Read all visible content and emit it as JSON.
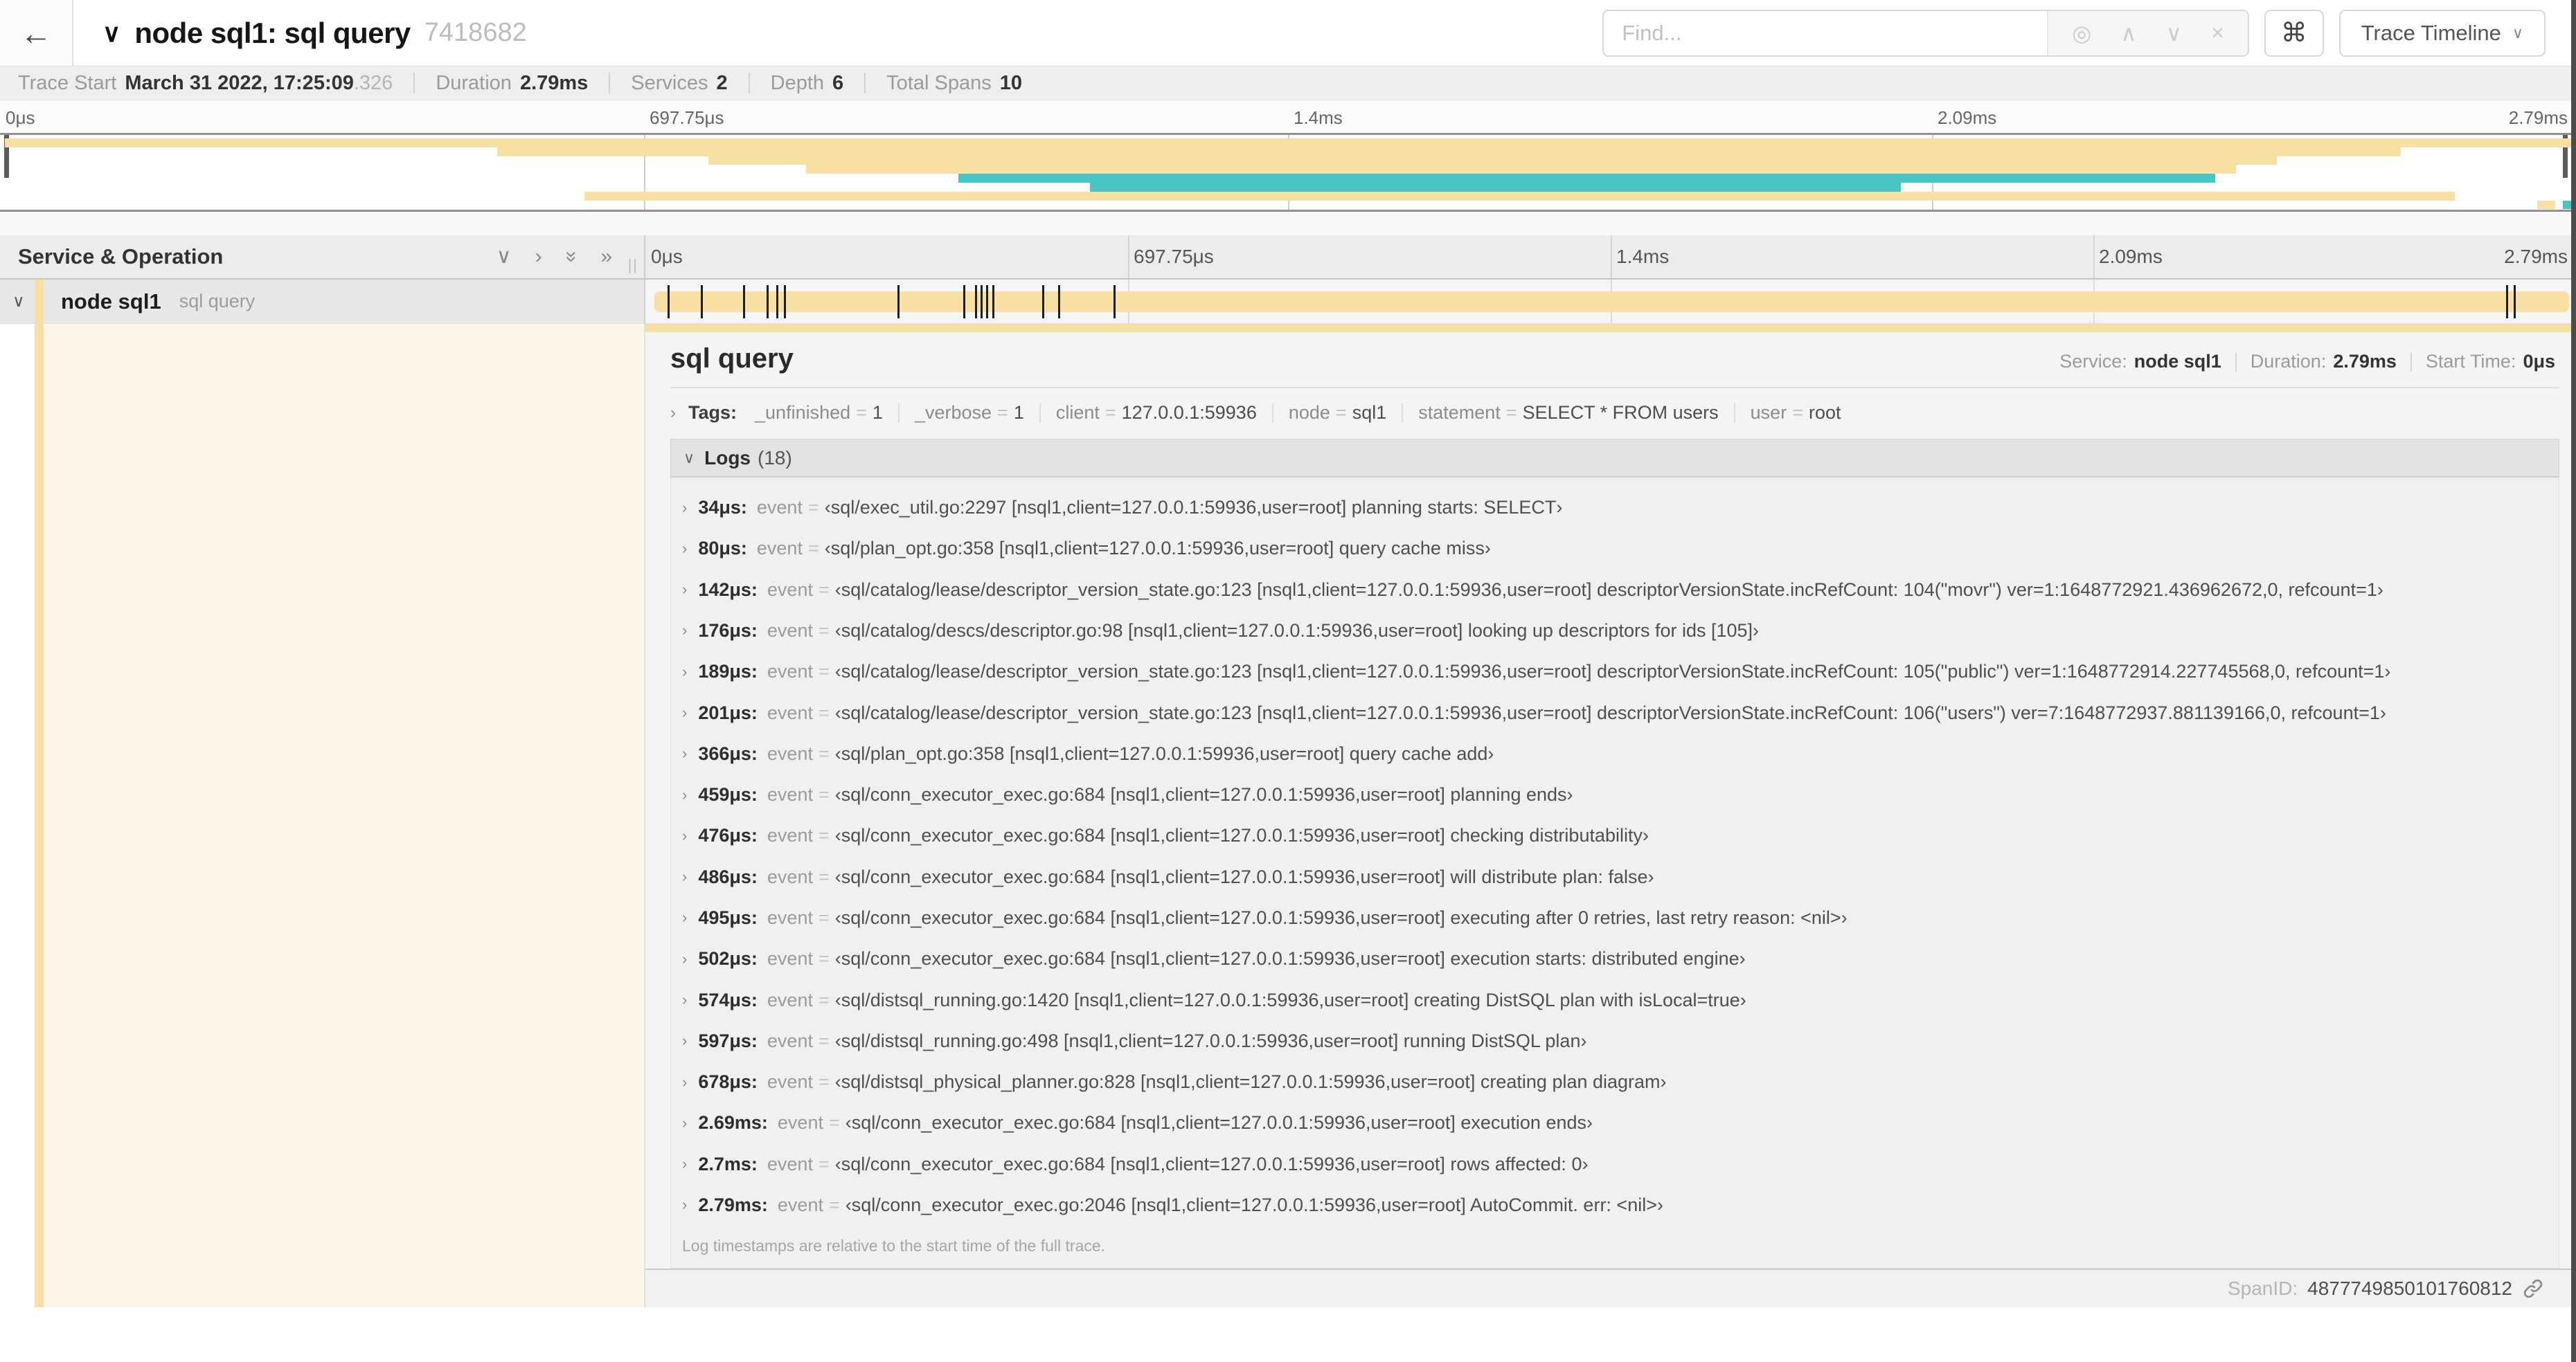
{
  "colors": {
    "tan": "#f8dfa4",
    "teal": "#49c6c3"
  },
  "icons": {
    "back": "←",
    "collapse": "∨",
    "locate": "◎",
    "prev": "∧",
    "next": "∨",
    "clear": "×",
    "shortcut": "⌘",
    "dropdown": "∨",
    "chevron_right": "›",
    "chevron_down": "∨",
    "double_right": "»",
    "grip": "||"
  },
  "header": {
    "title": "node sql1: sql query",
    "trace_id": "7418682",
    "find_placeholder": "Find...",
    "view_button": "Trace Timeline"
  },
  "stats": {
    "trace_start_label": "Trace Start",
    "trace_start": "March 31 2022, 17:25:09",
    "trace_start_frac": ".326",
    "duration_label": "Duration",
    "duration": "2.79ms",
    "services_label": "Services",
    "services": "2",
    "depth_label": "Depth",
    "depth": "6",
    "spans_label": "Total Spans",
    "spans": "10"
  },
  "ruler": {
    "labels": [
      "0μs",
      "697.75μs",
      "1.4ms",
      "2.09ms",
      "2.79ms"
    ]
  },
  "minimap": {
    "rows": [
      {
        "row": 0,
        "start": 0.2,
        "end": 99.8,
        "color": "tan"
      },
      {
        "row": 1,
        "start": 19.3,
        "end": 93.2,
        "color": "tan"
      },
      {
        "row": 2,
        "start": 27.5,
        "end": 88.4,
        "color": "tan"
      },
      {
        "row": 3,
        "start": 31.3,
        "end": 86.8,
        "color": "tan"
      },
      {
        "row": 4,
        "start": 37.2,
        "end": 86.0,
        "color": "teal"
      },
      {
        "row": 5,
        "start": 42.3,
        "end": 73.8,
        "color": "teal"
      },
      {
        "row": 6,
        "start": 22.7,
        "end": 95.3,
        "color": "tan"
      },
      {
        "row": 7,
        "start": 98.5,
        "end": 99.2,
        "color": "tan"
      },
      {
        "row": 7,
        "start": 99.5,
        "end": 100,
        "color": "teal"
      }
    ]
  },
  "tree": {
    "header": "Service & Operation",
    "service": "node sql1",
    "operation": "sql query"
  },
  "span_detail": {
    "title": "sql query",
    "service_label": "Service:",
    "service": "node sql1",
    "duration_label": "Duration:",
    "duration": "2.79ms",
    "start_label": "Start Time:",
    "start": "0μs",
    "tags_label": "Tags:",
    "tags": [
      {
        "key": "_unfinished",
        "value": "1"
      },
      {
        "key": "_verbose",
        "value": "1"
      },
      {
        "key": "client",
        "value": "127.0.0.1:59936"
      },
      {
        "key": "node",
        "value": "sql1"
      },
      {
        "key": "statement",
        "value": "SELECT * FROM users"
      },
      {
        "key": "user",
        "value": "root"
      }
    ],
    "logs_label": "Logs",
    "logs_count": "(18)",
    "log_key": "event",
    "logs": [
      {
        "time": "34μs:",
        "pct": 1.2,
        "value": "‹sql/exec_util.go:2297 [nsql1,client=127.0.0.1:59936,user=root] planning starts: SELECT›"
      },
      {
        "time": "80μs:",
        "pct": 2.9,
        "value": "‹sql/plan_opt.go:358 [nsql1,client=127.0.0.1:59936,user=root] query cache miss›"
      },
      {
        "time": "142μs:",
        "pct": 5.1,
        "value": "‹sql/catalog/lease/descriptor_version_state.go:123 [nsql1,client=127.0.0.1:59936,user=root] descriptorVersionState.incRefCount: 104(\"movr\") ver=1:1648772921.436962672,0, refcount=1›"
      },
      {
        "time": "176μs:",
        "pct": 6.3,
        "value": "‹sql/catalog/descs/descriptor.go:98 [nsql1,client=127.0.0.1:59936,user=root] looking up descriptors for ids [105]›"
      },
      {
        "time": "189μs:",
        "pct": 6.8,
        "value": "‹sql/catalog/lease/descriptor_version_state.go:123 [nsql1,client=127.0.0.1:59936,user=root] descriptorVersionState.incRefCount: 105(\"public\") ver=1:1648772914.227745568,0, refcount=1›"
      },
      {
        "time": "201μs:",
        "pct": 7.2,
        "value": "‹sql/catalog/lease/descriptor_version_state.go:123 [nsql1,client=127.0.0.1:59936,user=root] descriptorVersionState.incRefCount: 106(\"users\") ver=7:1648772937.881139166,0, refcount=1›"
      },
      {
        "time": "366μs:",
        "pct": 13.1,
        "value": "‹sql/plan_opt.go:358 [nsql1,client=127.0.0.1:59936,user=root] query cache add›"
      },
      {
        "time": "459μs:",
        "pct": 16.5,
        "value": "‹sql/conn_executor_exec.go:684 [nsql1,client=127.0.0.1:59936,user=root] planning ends›"
      },
      {
        "time": "476μs:",
        "pct": 17.1,
        "value": "‹sql/conn_executor_exec.go:684 [nsql1,client=127.0.0.1:59936,user=root] checking distributability›"
      },
      {
        "time": "486μs:",
        "pct": 17.4,
        "value": "‹sql/conn_executor_exec.go:684 [nsql1,client=127.0.0.1:59936,user=root] will distribute plan: false›"
      },
      {
        "time": "495μs:",
        "pct": 17.7,
        "value": "‹sql/conn_executor_exec.go:684 [nsql1,client=127.0.0.1:59936,user=root] executing after 0 retries, last retry reason: <nil>›"
      },
      {
        "time": "502μs:",
        "pct": 18.0,
        "value": "‹sql/conn_executor_exec.go:684 [nsql1,client=127.0.0.1:59936,user=root] execution starts: distributed engine›"
      },
      {
        "time": "574μs:",
        "pct": 20.6,
        "value": "‹sql/distsql_running.go:1420 [nsql1,client=127.0.0.1:59936,user=root] creating DistSQL plan with isLocal=true›"
      },
      {
        "time": "597μs:",
        "pct": 21.4,
        "value": "‹sql/distsql_running.go:498 [nsql1,client=127.0.0.1:59936,user=root] running DistSQL plan›"
      },
      {
        "time": "678μs:",
        "pct": 24.3,
        "value": "‹sql/distsql_physical_planner.go:828 [nsql1,client=127.0.0.1:59936,user=root] creating plan diagram›"
      },
      {
        "time": "2.69ms:",
        "pct": 96.4,
        "value": "‹sql/conn_executor_exec.go:684 [nsql1,client=127.0.0.1:59936,user=root] execution ends›"
      },
      {
        "time": "2.7ms:",
        "pct": 96.8,
        "value": "‹sql/conn_executor_exec.go:684 [nsql1,client=127.0.0.1:59936,user=root] rows affected: 0›"
      },
      {
        "time": "2.79ms:",
        "pct": 99.9,
        "value": "‹sql/conn_executor_exec.go:2046 [nsql1,client=127.0.0.1:59936,user=root] AutoCommit. err: <nil>›"
      }
    ],
    "note": "Log timestamps are relative to the start time of the full trace.",
    "spanid_label": "SpanID:",
    "span_id": "4877749850101760812"
  }
}
